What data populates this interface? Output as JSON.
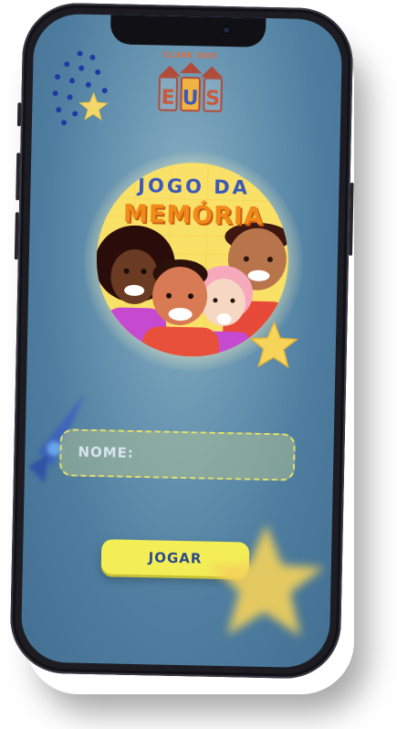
{
  "logo": {
    "arc_text": "CLUBE DOS",
    "letters": [
      "E",
      "U",
      "S"
    ]
  },
  "game": {
    "title_top": "JOGO DA",
    "title_main": "MEMÓRIA"
  },
  "form": {
    "name_placeholder": "NOME:"
  },
  "actions": {
    "play_label": "JOGAR"
  },
  "colors": {
    "background": "#4f7ea0",
    "accent_yellow": "#f4ee56",
    "title_orange": "#f08a1a",
    "title_blue": "#3d58b8"
  },
  "icons": [
    "star-icon",
    "rocket-icon",
    "dots-pattern-icon",
    "kids-illustration"
  ]
}
